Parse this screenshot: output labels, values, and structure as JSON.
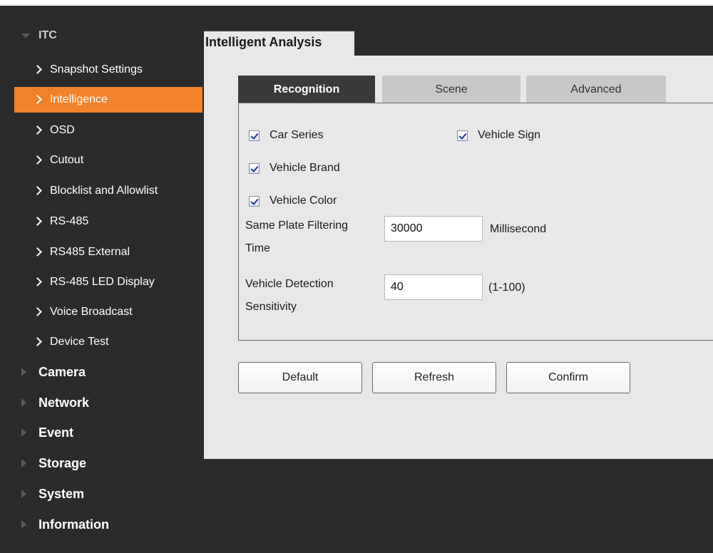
{
  "sidebar": {
    "itc_label": "ITC",
    "itc_items": [
      {
        "label": "Snapshot Settings"
      },
      {
        "label": "Intelligence",
        "active": true
      },
      {
        "label": "OSD"
      },
      {
        "label": "Cutout"
      },
      {
        "label": "Blocklist and Allowlist"
      },
      {
        "label": "RS-485"
      },
      {
        "label": "RS485 External"
      },
      {
        "label": "RS-485 LED Display"
      },
      {
        "label": "Voice Broadcast"
      },
      {
        "label": "Device Test"
      }
    ],
    "sections": [
      {
        "label": "Camera"
      },
      {
        "label": "Network"
      },
      {
        "label": "Event"
      },
      {
        "label": "Storage"
      },
      {
        "label": "System"
      },
      {
        "label": "Information"
      }
    ]
  },
  "main": {
    "title": "Intelligent Analysis",
    "tabs": [
      {
        "label": "Recognition",
        "active": true
      },
      {
        "label": "Scene"
      },
      {
        "label": "Advanced"
      }
    ],
    "checkboxes": {
      "car_series": {
        "label": "Car Series",
        "checked": true
      },
      "vehicle_sign": {
        "label": "Vehicle Sign",
        "checked": true
      },
      "vehicle_brand": {
        "label": "Vehicle Brand",
        "checked": true
      },
      "vehicle_color": {
        "label": "Vehicle Color",
        "checked": true
      }
    },
    "same_plate": {
      "label_line1": "Same Plate Filtering",
      "label_line2": "Time",
      "value": "30000",
      "unit": "Millisecond"
    },
    "sensitivity": {
      "label_line1": "Vehicle Detection",
      "label_line2": "Sensitivity",
      "value": "40",
      "range": "(1-100)"
    },
    "buttons": {
      "default": "Default",
      "refresh": "Refresh",
      "confirm": "Confirm"
    }
  },
  "colors": {
    "accent": "#f2822a",
    "sidebar_bg": "#2b2b2b",
    "content_bg": "#e8e8e8",
    "tab_active_bg": "#3a3a3a"
  }
}
